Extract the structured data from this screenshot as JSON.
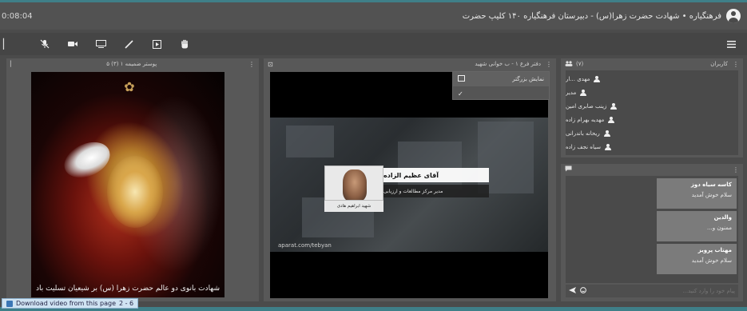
{
  "title_bar": {
    "time": "0:08:04",
    "title": "فرهنگیاره • شهادت حضرت زهرا(س) - دبیرستان فرهنگیاره ۱۴۰ کلیپ حضرت"
  },
  "toolbar": {
    "left_icon": "chevron-icon",
    "buttons": [
      "mic-off-icon",
      "camera-icon",
      "screen-share-icon",
      "laptop-icon",
      "pen-icon",
      "play-box-icon",
      "hand-icon"
    ],
    "menu_icon": "hamburger-menu-icon"
  },
  "left_panel": {
    "header": "پوستر ضمیمه ۱ (۳) ۵",
    "poster_caption": "شهادت بانوی دو عالم حضرت زهرا (س) بر شیعیان تسلیت باد"
  },
  "middle_panel": {
    "header": "دفتر فرع ۱ - ب خوانی شهید",
    "dropdown": {
      "items": [
        {
          "label": "نمایش بزرگتر",
          "icon": "fullscreen-icon"
        },
        {
          "label": "",
          "icon": "check-icon"
        }
      ]
    },
    "lower_third": {
      "name": "آقای عظیم الزاده",
      "role": "مدیر مرکز مطالعات و ارزیابی",
      "sub": "شهید ابراهیم هادی"
    },
    "video_url": "aparat.com/tebyan"
  },
  "users_panel": {
    "header": "کاربران",
    "count": "(۷)",
    "users": [
      {
        "name": "مهدی ...ار"
      },
      {
        "name": "مدیر"
      },
      {
        "name": "زینب صابری امین"
      },
      {
        "name": "مهدیه بهرام زاده"
      },
      {
        "name": "ریحانه باندرانی"
      },
      {
        "name": "سیاه نجف زاده"
      }
    ]
  },
  "chat_panel": {
    "header": "گفتگو",
    "messages": [
      {
        "who": "کاسه سیاه دوز",
        "text": "سلام خوش آمدید"
      },
      {
        "who": "والدین",
        "text": "ممنون و..."
      },
      {
        "who": "مهتاب پرویز",
        "text": "سلام خوش آمدید"
      }
    ],
    "input_placeholder": "پیام خود را وارد کنید..."
  },
  "download_bar": {
    "label": "Download video from this page",
    "count": "2 - 6"
  },
  "colors": {
    "frame": "#3f7f88",
    "app_bg": "#4b4b4b",
    "panel_bg": "#585858",
    "chat_bubble": "#7b7b7b"
  }
}
